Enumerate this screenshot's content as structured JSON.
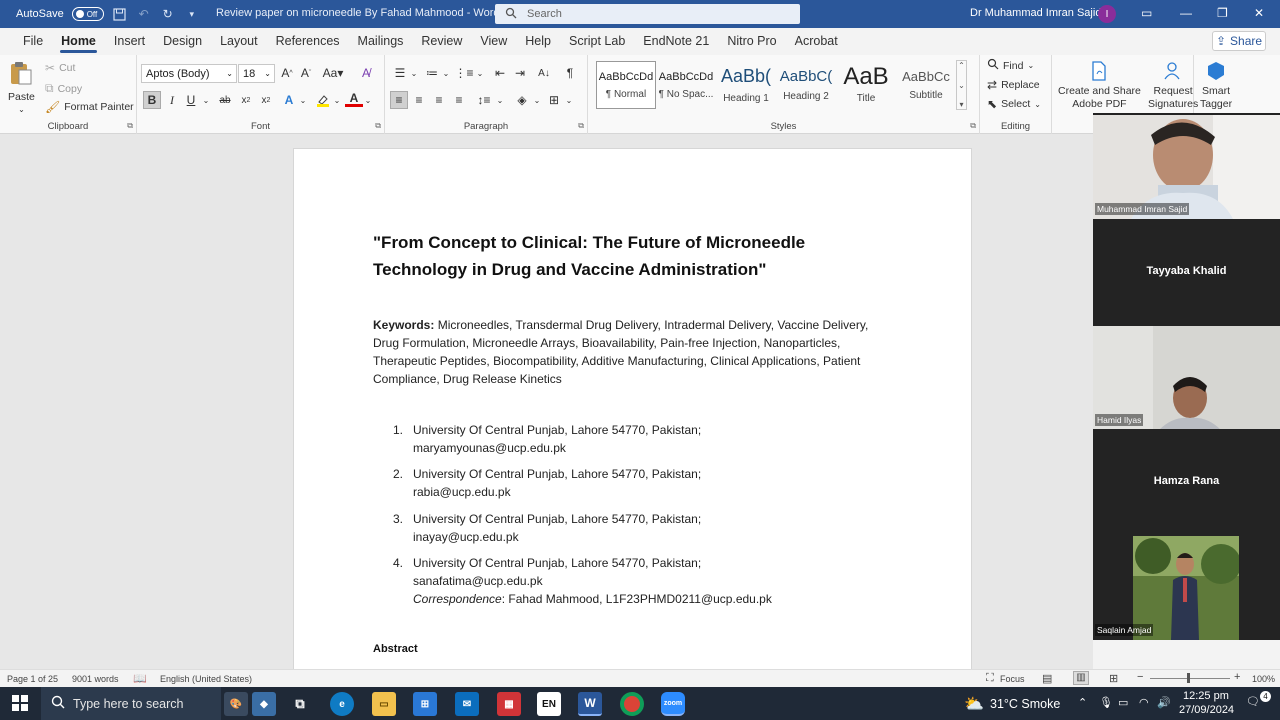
{
  "titlebar": {
    "autosave_label": "AutoSave",
    "autosave_state": "Off",
    "document_title": "Review paper on microneedle By Fahad Mahmood  -  Word",
    "search_placeholder": "Search",
    "user_name": "Dr Muhammad Imran Sajid",
    "user_initial": "I"
  },
  "menu": {
    "items": [
      "File",
      "Home",
      "Insert",
      "Design",
      "Layout",
      "References",
      "Mailings",
      "Review",
      "View",
      "Help",
      "Script Lab",
      "EndNote 21",
      "Nitro Pro",
      "Acrobat"
    ],
    "active": "Home",
    "share_label": "Share"
  },
  "ribbon": {
    "clipboard": {
      "paste": "Paste",
      "cut": "Cut",
      "copy": "Copy",
      "format_painter": "Format Painter",
      "label": "Clipboard"
    },
    "font": {
      "font_name": "Aptos (Body)",
      "font_size": "18",
      "label": "Font"
    },
    "paragraph": {
      "label": "Paragraph"
    },
    "styles": {
      "label": "Styles",
      "items": [
        {
          "sample": "AaBbCcDd",
          "name": "¶ Normal"
        },
        {
          "sample": "AaBbCcDd",
          "name": "¶ No Spac..."
        },
        {
          "sample": "AaBb(",
          "name": "Heading 1"
        },
        {
          "sample": "AaBbC(",
          "name": "Heading 2"
        },
        {
          "sample": "AaB",
          "name": "Title"
        },
        {
          "sample": "AaBbCc",
          "name": "Subtitle"
        }
      ]
    },
    "editing": {
      "find": "Find",
      "replace": "Replace",
      "select": "Select",
      "label": "Editing"
    },
    "adobe": {
      "create_share_1": "Create and Share",
      "create_share_2": "Adobe PDF",
      "request_1": "Request",
      "request_2": "Signatures"
    },
    "smart_tagger": {
      "line1": "Smart",
      "line2": "Tagger"
    }
  },
  "document": {
    "title_line1": "\"From Concept to Clinical: The Future of Microneedle",
    "title_line2": "Technology in Drug and Vaccine Administration\"",
    "keywords_label": "Keywords:",
    "keywords": "  Microneedles, Transdermal Drug Delivery, Intradermal Delivery, Vaccine Delivery, Drug Formulation, Microneedle Arrays, Bioavailability, Pain-free Injection, Nanoparticles, Therapeutic Peptides, Biocompatibility, Additive Manufacturing, Clinical Applications, Patient Compliance, Drug Release Kinetics",
    "affiliations": [
      {
        "num": "1.",
        "line1": "University Of Central Punjab, Lahore 54770, Pakistan;",
        "line2": "maryamyounas@ucp.edu.pk"
      },
      {
        "num": "2.",
        "line1": "University Of Central Punjab, Lahore 54770, Pakistan;",
        "line2": "rabia@ucp.edu.pk"
      },
      {
        "num": "3.",
        "line1": "University Of Central Punjab, Lahore 54770, Pakistan;",
        "line2": "inayay@ucp.edu.pk"
      },
      {
        "num": "4.",
        "line1": "University Of Central Punjab, Lahore 54770, Pakistan;",
        "line2": "sanafatima@ucp.edu.pk"
      }
    ],
    "correspondence_label": "Correspondence",
    "correspondence_text": ": Fahad Mahmood, L1F23PHMD0211@ucp.edu.pk",
    "abstract_heading": "Abstract"
  },
  "participants": [
    {
      "name": "Muhammad Imran Sajid",
      "video": true
    },
    {
      "name": "Tayyaba Khalid",
      "video": false
    },
    {
      "name": "Hamid Ilyas",
      "video": true
    },
    {
      "name": "Hamza Rana",
      "video": false
    },
    {
      "name": "Saqlain Amjad",
      "video": true
    }
  ],
  "statusbar": {
    "page": "Page 1 of 25",
    "words": "9001 words",
    "language": "English (United States)",
    "focus": "Focus",
    "zoom": "100%"
  },
  "taskbar": {
    "search_placeholder": "Type here to search",
    "weather": "31°C  Smoke",
    "time": "12:25 pm",
    "date": "27/09/2024",
    "notification_count": "4",
    "lang_badge": "EN"
  },
  "colors": {
    "word_blue": "#2b579a",
    "taskbar": "#1f2937"
  }
}
